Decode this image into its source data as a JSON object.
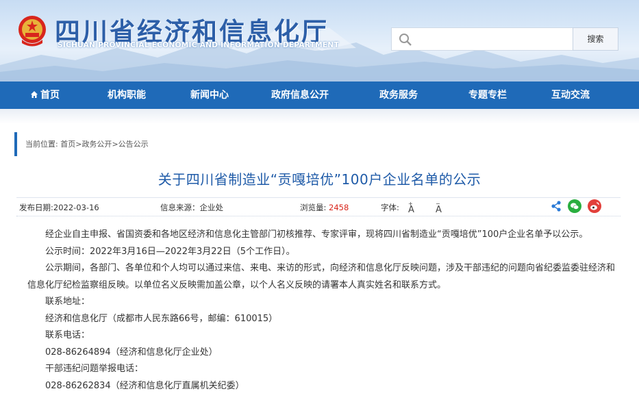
{
  "header": {
    "site_title": "四川省经济和信息化厅",
    "site_subtitle": "SICHUAN PROVINCIAL ECONOMIC AND INFORMATION DEPARTMENT",
    "search_placeholder": "",
    "search_button": "搜索"
  },
  "nav": {
    "items": [
      {
        "label": "首页"
      },
      {
        "label": "机构职能"
      },
      {
        "label": "新闻中心"
      },
      {
        "label": "政府信息公开"
      },
      {
        "label": "政务服务"
      },
      {
        "label": "专题专栏"
      },
      {
        "label": "互动交流"
      }
    ]
  },
  "breadcrumb": {
    "prefix": "当前位置:",
    "items": [
      "首页",
      "政务公开",
      "公告公示"
    ],
    "sep": ">"
  },
  "article": {
    "title": "关于四川省制造业“贡嘎培优”100户企业名单的公示",
    "meta": {
      "publish_date": "发布日期:2022-03-16",
      "source": "信息来源：企业处",
      "views_label": "浏览量:",
      "views": "2458",
      "font_label": "字体:",
      "font_larger": "A",
      "font_smaller": "A"
    },
    "paragraphs": [
      "经企业自主申报、省国资委和各地区经济和信息化主管部门初核推荐、专家评审，现将四川省制造业“贡嘎培优”100户企业名单予以公示。",
      "公示时间：2022年3月16日—2022年3月22日（5个工作日）。",
      "公示期间，各部门、各单位和个人均可以通过来信、来电、来访的形式，向经济和信息化厅反映问题，涉及干部违纪的问题向省纪委监委驻经济和信息化厅纪检监察组反映。以单位名义反映需加盖公章，以个人名义反映的请署本人真实姓名和联系方式。",
      "联系地址：",
      "经济和信息化厅（成都市人民东路66号，邮编：610015）",
      "联系电话：",
      "028-86264894（经济和信息化厅企业处）",
      "干部违纪问题举报电话：",
      "028-86262834（经济和信息化厅直属机关纪委）"
    ]
  },
  "colors": {
    "nav_bg": "#1f6ab8",
    "title": "#1f5ba8",
    "views": "#d9261c"
  }
}
